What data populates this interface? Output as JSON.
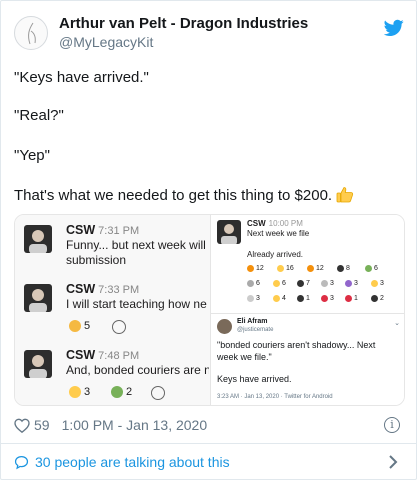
{
  "author": {
    "name": "Arthur van Pelt - Dragon Industries",
    "handle": "@MyLegacyKit"
  },
  "tweet": {
    "lines": [
      "\"Keys have arrived.\"",
      "\"Real?\"",
      "\"Yep\"",
      "That's what we needed to get this thing to $200."
    ]
  },
  "media": {
    "slack_messages": [
      {
        "user": "CSW",
        "time": "7:31 PM",
        "text": [
          "Funny... but next week will",
          "submission"
        ]
      },
      {
        "user": "CSW",
        "time": "7:33 PM",
        "text": [
          "I will start teaching how ne"
        ]
      },
      {
        "user": "CSW",
        "time": "7:48 PM",
        "text": [
          "And, bonded couriers are n"
        ]
      }
    ],
    "reactions_1": [
      "5"
    ],
    "reactions_3": [
      "3",
      "2"
    ],
    "inset_slack": {
      "user": "CSW",
      "time": "10:00 PM",
      "line1": "Next week we file",
      "line2": "Already arrived.",
      "reactions_row1": [
        "12",
        "16",
        "12",
        "8",
        "6"
      ],
      "reactions_row2": [
        "6",
        "6",
        "7",
        "3",
        "3",
        "3"
      ],
      "reactions_row3": [
        "3",
        "4",
        "1",
        "3",
        "1",
        "2"
      ]
    },
    "quote_tweet": {
      "name": "Eli Afram",
      "handle": "@justicemate",
      "line1": "\"bonded couriers aren't shadowy... Next",
      "line2": "week we file.\"",
      "line3": "Keys have arrived.",
      "meta": "3:23 AM · Jan 13, 2020 · Twitter for Android"
    }
  },
  "footer": {
    "likes": "59",
    "datetime": "1:00 PM - Jan 13, 2020",
    "talking": "30 people are talking about this"
  },
  "colors": {
    "twitter_blue": "#1da1f2",
    "link_blue": "#1b95e0",
    "muted": "#657786"
  },
  "icons": [
    "bird-icon",
    "heart-icon",
    "info-icon",
    "speech-bubble-icon",
    "chevron-right-icon",
    "thumbs-up-emoji"
  ]
}
